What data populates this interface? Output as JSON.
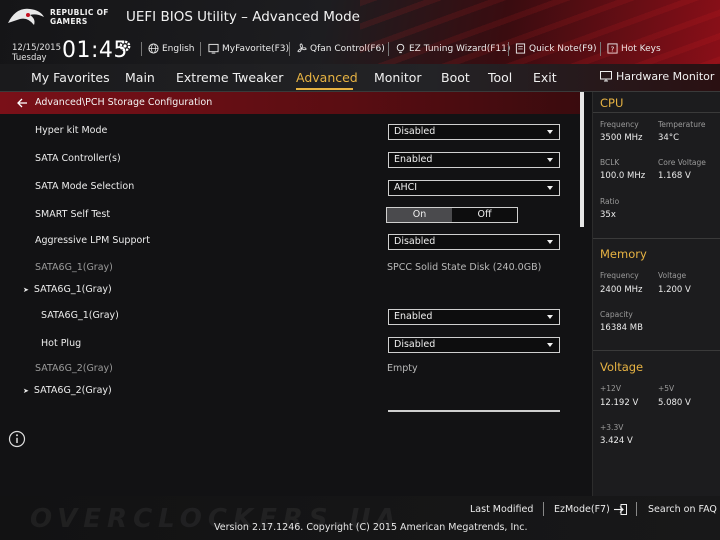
{
  "brand": {
    "line1": "REPUBLIC OF",
    "line2": "GAMERS"
  },
  "app_title": "UEFI BIOS Utility – Advanced Mode",
  "datetime": {
    "date": "12/15/2015",
    "day": "Tuesday",
    "time": "01:45"
  },
  "toolbar": {
    "language": "English",
    "favorite": "MyFavorite(F3)",
    "qfan": "Qfan Control(F6)",
    "ez_tuning": "EZ Tuning Wizard(F11)",
    "quick_note": "Quick Note(F9)",
    "hot_keys": "Hot Keys"
  },
  "menu": {
    "items": [
      "My Favorites",
      "Main",
      "Extreme Tweaker",
      "Advanced",
      "Monitor",
      "Boot",
      "Tool",
      "Exit"
    ],
    "active": "Advanced",
    "hardware_monitor": "Hardware Monitor"
  },
  "breadcrumb": "Advanced\\PCH Storage Configuration",
  "settings": {
    "hyper_kit": {
      "label": "Hyper kit Mode",
      "value": "Disabled"
    },
    "sata_controller": {
      "label": "SATA Controller(s)",
      "value": "Enabled"
    },
    "sata_mode": {
      "label": "SATA Mode Selection",
      "value": "AHCI"
    },
    "smart": {
      "label": "SMART Self Test",
      "on": "On",
      "off": "Off",
      "selected": "On"
    },
    "lpm": {
      "label": "Aggressive LPM Support",
      "value": "Disabled"
    },
    "port1_info": {
      "label": "SATA6G_1(Gray)",
      "value": "SPCC Solid State Disk (240.0GB)"
    },
    "port1_expander": {
      "label": "SATA6G_1(Gray)"
    },
    "port1_enable": {
      "label": "SATA6G_1(Gray)",
      "value": "Enabled"
    },
    "port1_hotplug": {
      "label": "Hot Plug",
      "value": "Disabled"
    },
    "port2_info": {
      "label": "SATA6G_2(Gray)",
      "value": "Empty"
    },
    "port2_expander": {
      "label": "SATA6G_2(Gray)"
    }
  },
  "hardware_monitor": {
    "cpu": {
      "title": "CPU",
      "frequency_label": "Frequency",
      "frequency": "3500 MHz",
      "temperature_label": "Temperature",
      "temperature": "34°C",
      "bclk_label": "BCLK",
      "bclk": "100.0 MHz",
      "core_voltage_label": "Core Voltage",
      "core_voltage": "1.168 V",
      "ratio_label": "Ratio",
      "ratio": "35x"
    },
    "memory": {
      "title": "Memory",
      "frequency_label": "Frequency",
      "frequency": "2400 MHz",
      "voltage_label": "Voltage",
      "voltage": "1.200 V",
      "capacity_label": "Capacity",
      "capacity": "16384 MB"
    },
    "voltage": {
      "title": "Voltage",
      "v12_label": "+12V",
      "v12": "12.192 V",
      "v5_label": "+5V",
      "v5": "5.080 V",
      "v33_label": "+3.3V",
      "v33": "3.424 V"
    }
  },
  "footer": {
    "last_modified": "Last Modified",
    "ezmode": "EzMode(F7)",
    "search": "Search on FAQ",
    "version": "Version 2.17.1246. Copyright (C) 2015 American Megatrends, Inc.",
    "watermark": "OVERCLOCKERS.UA"
  },
  "colors": {
    "accent": "#e7b343",
    "breadcrumb_bg": "#7a1018",
    "panel_bg": "#1c1c1e"
  }
}
